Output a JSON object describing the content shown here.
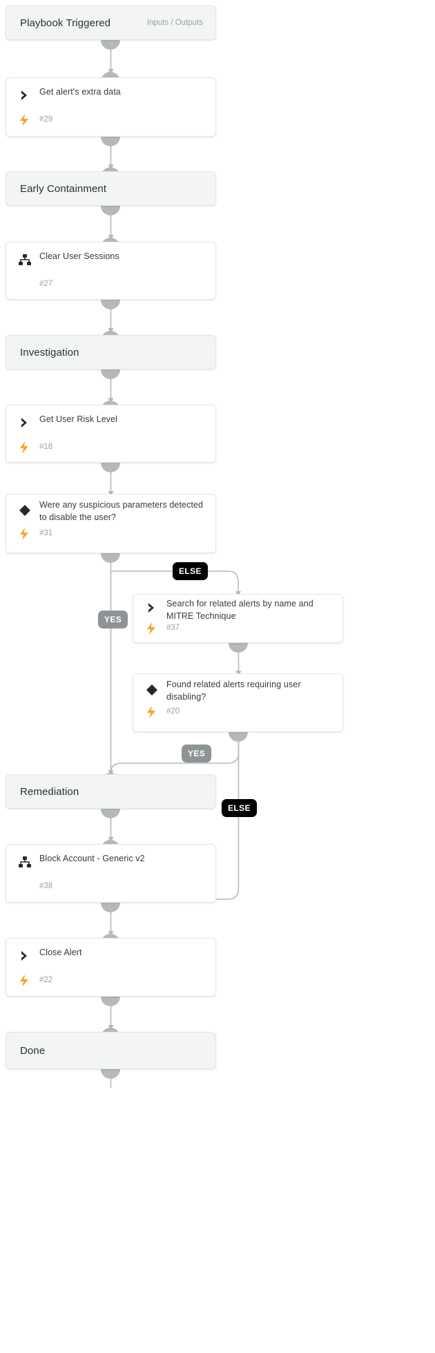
{
  "diagram": {
    "title": "Playbook workflow",
    "colors": {
      "section_bg": "#f3f5f5",
      "node_bg": "#ffffff",
      "border": "#e4e6e6",
      "connector": "#b5b9ba",
      "badge_else_bg": "#000000",
      "badge_yes_bg": "#8e9495",
      "bolt": "#f5a623",
      "icon_dark": "#2b2f31",
      "text_primary": "#36393b",
      "text_muted": "#9aa0a3"
    }
  },
  "nodes": [
    {
      "id": "playbook-triggered",
      "kind": "section",
      "label": "Playbook Triggered",
      "meta": "Inputs / Outputs"
    },
    {
      "id": "get-alerts-extra-data",
      "kind": "task",
      "icon": "chevron-right-icon",
      "label": "Get alert's extra data",
      "task_id": "#29",
      "has_bolt": true
    },
    {
      "id": "early-containment",
      "kind": "section",
      "label": "Early Containment",
      "meta": ""
    },
    {
      "id": "clear-user-sessions",
      "kind": "task",
      "icon": "sitemap-icon",
      "label": "Clear User Sessions",
      "task_id": "#27",
      "has_bolt": false
    },
    {
      "id": "investigation",
      "kind": "section",
      "label": "Investigation",
      "meta": ""
    },
    {
      "id": "get-user-risk-level",
      "kind": "task",
      "icon": "chevron-right-icon",
      "label": "Get User Risk Level",
      "task_id": "#18",
      "has_bolt": true
    },
    {
      "id": "suspicious-parameters-condition",
      "kind": "condition",
      "icon": "diamond-icon",
      "label": "Were any suspicious parameters detected to disable the user?",
      "task_id": "#31",
      "has_bolt": true
    },
    {
      "id": "search-related-alerts",
      "kind": "task",
      "icon": "chevron-right-icon",
      "label": "Search for related alerts by name and MITRE Technique",
      "task_id": "#37",
      "has_bolt": true
    },
    {
      "id": "found-related-alerts-condition",
      "kind": "condition",
      "icon": "diamond-icon",
      "label": "Found related alerts requiring user disabling?",
      "task_id": "#20",
      "has_bolt": true
    },
    {
      "id": "remediation",
      "kind": "section",
      "label": "Remediation",
      "meta": ""
    },
    {
      "id": "block-account-generic-v2",
      "kind": "task",
      "icon": "sitemap-icon",
      "label": "Block Account - Generic v2",
      "task_id": "#38",
      "has_bolt": false
    },
    {
      "id": "close-alert",
      "kind": "task",
      "icon": "chevron-right-icon",
      "label": "Close Alert",
      "task_id": "#22",
      "has_bolt": true
    },
    {
      "id": "done",
      "kind": "section",
      "label": "Done",
      "meta": ""
    }
  ],
  "branch_labels": [
    {
      "id": "else-1",
      "text": "ELSE",
      "style": "else"
    },
    {
      "id": "yes-1",
      "text": "YES",
      "style": "yes"
    },
    {
      "id": "yes-2",
      "text": "YES",
      "style": "yes"
    },
    {
      "id": "else-2",
      "text": "ELSE",
      "style": "else"
    }
  ]
}
